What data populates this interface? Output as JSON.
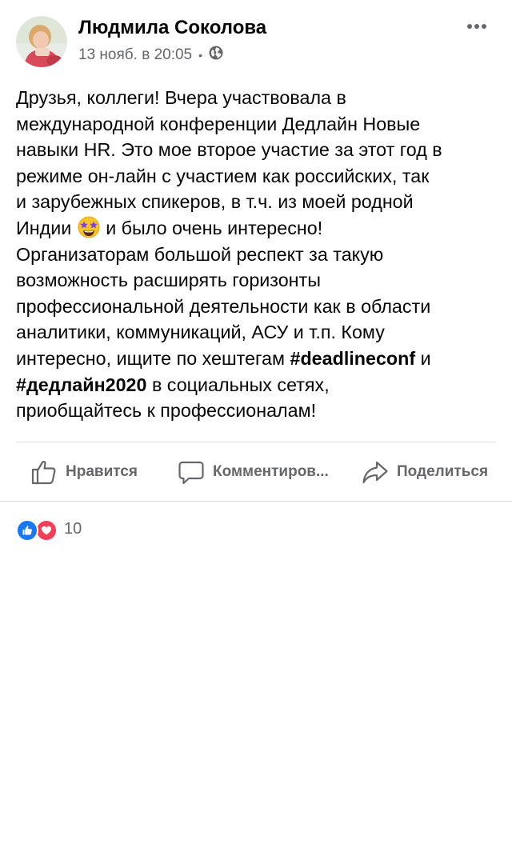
{
  "post": {
    "author": "Людмила Соколова",
    "date": "13 нояб. в 20:05",
    "separator": "•",
    "privacy_icon": "globe-icon",
    "more_icon": "more-horizontal-icon",
    "text_part1": "Друзья, коллеги! Вчера участвовала в\nмеждународной конференции Дедлайн Новые\nнавыки HR. Это мое второе участие за этот год в\nрежиме он-лайн с участием как российских, так\nи зарубежных спикеров, в т.ч. из моей родной\nИндии ",
    "emoji": "star-struck-emoji",
    "text_part2": " и было очень интересно!\nОрганизаторам большой респект за такую\nвозможность расширять горизонты\nпрофессиональной деятельности как в области\nаналитики, коммуникаций, АСУ и т.п. Кому\nинтересно, ищите по хештегам  ",
    "hashtag1": "#deadlineconf",
    "text_part3": " и\n",
    "hashtag2": "#дедлайн2020",
    "text_part4": "  в социальных сетях,\nприобщайтесь к профессионалам!"
  },
  "actions": {
    "like_label": "Нравится",
    "comment_label": "Комментиров...",
    "share_label": "Поделиться"
  },
  "reactions": {
    "types": [
      "like",
      "love"
    ],
    "count": "10",
    "colors": {
      "like": "#1877f2",
      "love": "#f33e58"
    }
  }
}
